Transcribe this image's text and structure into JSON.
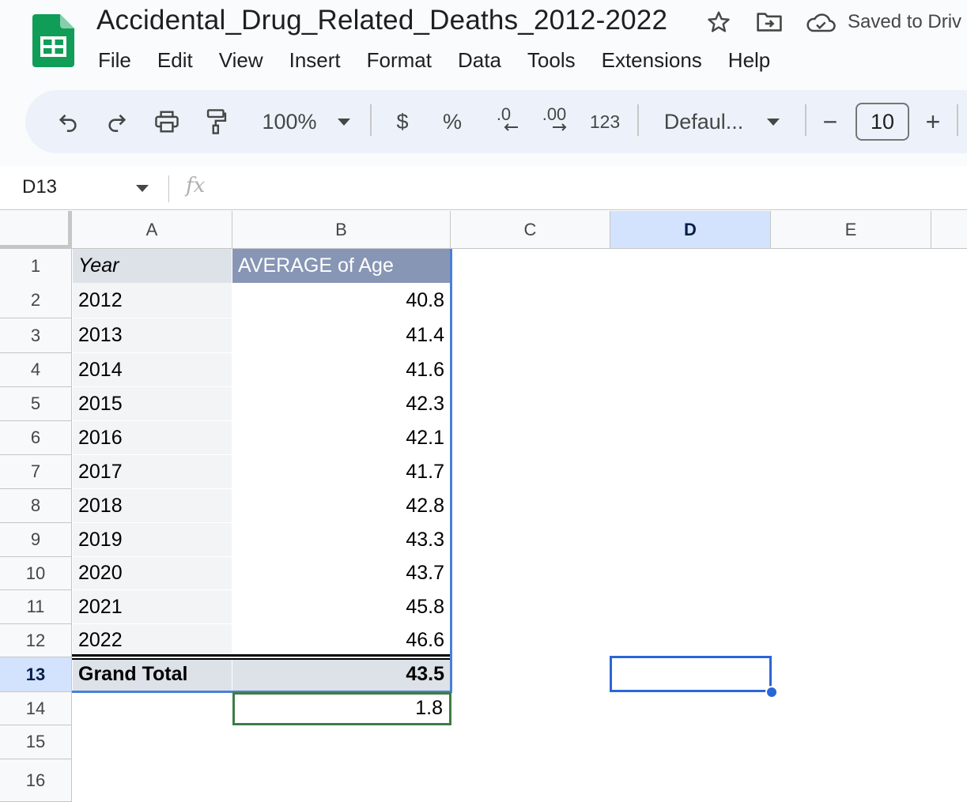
{
  "doc": {
    "title": "Accidental_Drug_Related_Deaths_2012-2022",
    "save_status": "Saved to Driv"
  },
  "menu": [
    "File",
    "Edit",
    "View",
    "Insert",
    "Format",
    "Data",
    "Tools",
    "Extensions",
    "Help"
  ],
  "toolbar": {
    "zoom": "100%",
    "currency": "$",
    "percent": "%",
    "decrease_decimal": ".0",
    "increase_decimal": ".00",
    "number_format": "123",
    "font": "Defaul...",
    "minus": "−",
    "font_size": "10",
    "plus": "+"
  },
  "formula_bar": {
    "cell_ref": "D13",
    "fx": "fx",
    "value": ""
  },
  "grid": {
    "columns": [
      "A",
      "B",
      "C",
      "D",
      "E"
    ],
    "active_column": "D",
    "rows": [
      "1",
      "2",
      "3",
      "4",
      "5",
      "6",
      "7",
      "8",
      "9",
      "10",
      "11",
      "12",
      "13",
      "14",
      "15",
      "16"
    ],
    "active_row": "13",
    "pivot": {
      "header_year": "Year",
      "header_value": "AVERAGE of Age",
      "years": [
        "2012",
        "2013",
        "2014",
        "2015",
        "2016",
        "2017",
        "2018",
        "2019",
        "2020",
        "2021",
        "2022"
      ],
      "ages": [
        "40.8",
        "41.4",
        "41.6",
        "42.3",
        "42.1",
        "41.7",
        "42.8",
        "43.3",
        "43.7",
        "45.8",
        "46.6"
      ],
      "total_label": "Grand Total",
      "total_value": "43.5"
    },
    "b14": "1.8"
  },
  "colors": {
    "pivot_header": "#8896b5",
    "selection_blue": "#2a66d8",
    "selection_green": "#3e7d45",
    "sheets_green": "#0f9d58"
  }
}
